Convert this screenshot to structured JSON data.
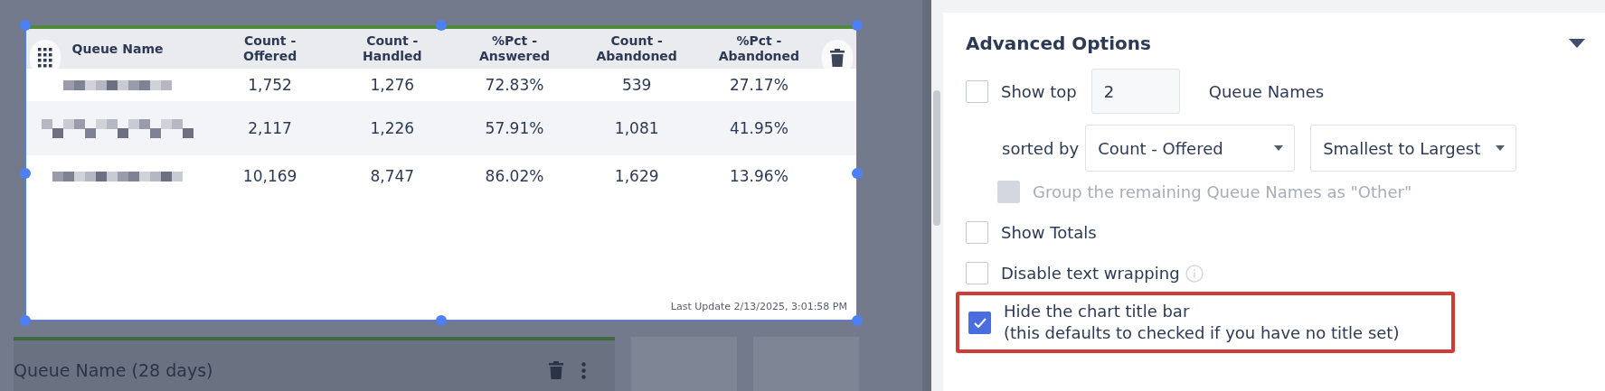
{
  "widget": {
    "columns": [
      {
        "label": "Queue Name"
      },
      {
        "label": "Count -\nOffered"
      },
      {
        "label": "Count -\nHandled"
      },
      {
        "label": "%Pct -\nAnswered"
      },
      {
        "label": "Count -\nAbandoned"
      },
      {
        "label": "%Pct -\nAbandoned"
      }
    ],
    "rows": [
      {
        "values": [
          "1,752",
          "1,276",
          "72.83%",
          "539",
          "27.17%"
        ]
      },
      {
        "values": [
          "2,117",
          "1,226",
          "57.91%",
          "1,081",
          "41.95%"
        ]
      },
      {
        "values": [
          "10,169",
          "8,747",
          "86.02%",
          "1,629",
          "13.96%"
        ]
      }
    ],
    "last_update": "Last Update 2/13/2025, 3:01:58 PM"
  },
  "background_card": {
    "title": "Queue Name (28 days)"
  },
  "panel": {
    "section_title": "Advanced Options",
    "expanded": true,
    "show_top": {
      "label": "Show top",
      "checked": false,
      "value": "2",
      "suffix": "Queue Names"
    },
    "sorted_by": {
      "label": "sorted by",
      "field": "Count - Offered",
      "order": "Smallest to Largest"
    },
    "group_other": {
      "label": "Group the remaining Queue Names as \"Other\"",
      "checked": false,
      "disabled": true
    },
    "options": [
      {
        "label": "Show Totals",
        "checked": false,
        "info": false,
        "highlighted": false
      },
      {
        "label": "Disable text wrapping",
        "checked": false,
        "info": true,
        "highlighted": false
      },
      {
        "label": "Hide the chart title bar",
        "note": "(this defaults to checked if you have no title set)",
        "checked": true,
        "info": false,
        "highlighted": true
      }
    ]
  }
}
